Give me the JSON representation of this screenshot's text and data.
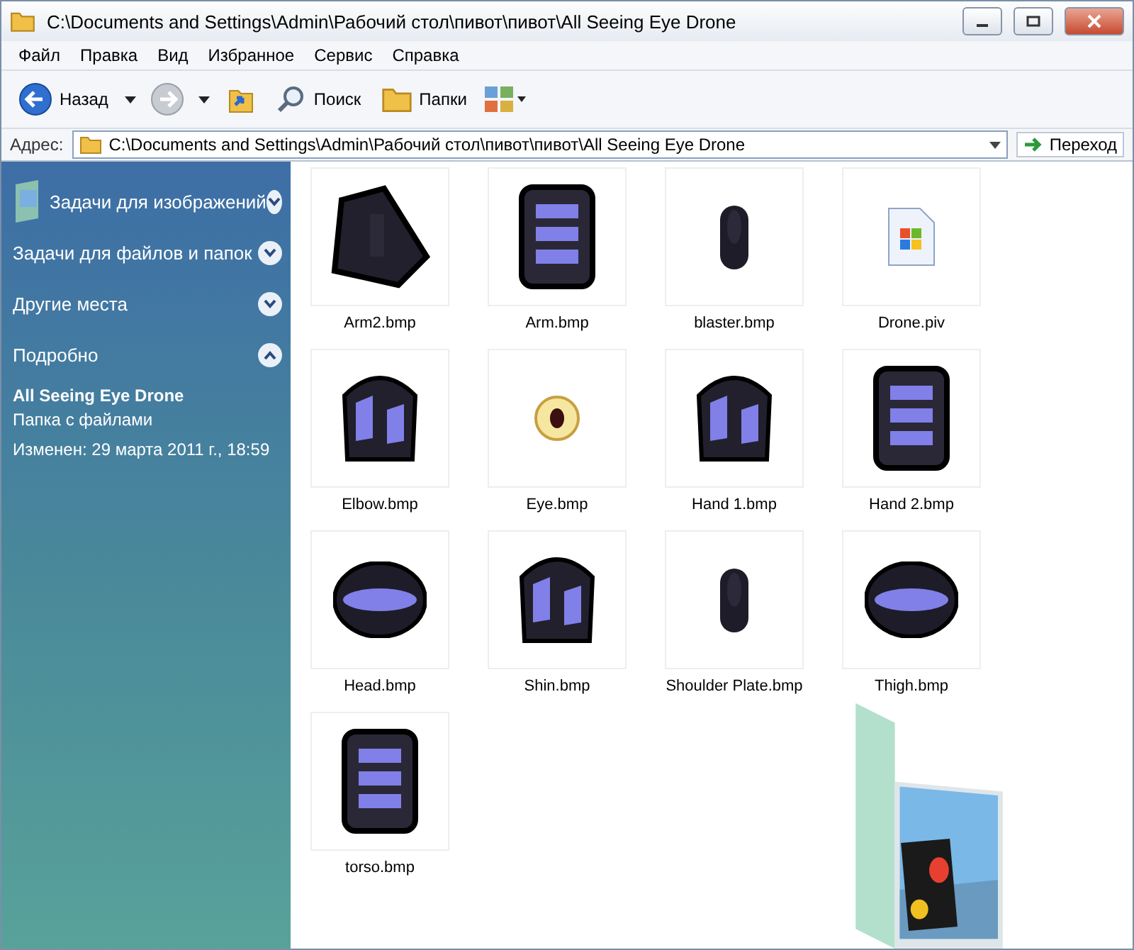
{
  "window": {
    "title": "C:\\Documents and Settings\\Admin\\Рабочий стол\\пивот\\пивот\\All Seeing Eye Drone"
  },
  "menu": [
    "Файл",
    "Правка",
    "Вид",
    "Избранное",
    "Сервис",
    "Справка"
  ],
  "toolbar": {
    "back": "Назад",
    "search": "Поиск",
    "folders": "Папки"
  },
  "address": {
    "label": "Адрес:",
    "value": "C:\\Documents and Settings\\Admin\\Рабочий стол\\пивот\\пивот\\All Seeing Eye Drone",
    "go": "Переход"
  },
  "sidebar": {
    "sections": [
      {
        "title": "Задачи для изображений",
        "expanded": false
      },
      {
        "title": "Задачи для файлов и папок",
        "expanded": false
      },
      {
        "title": "Другие места",
        "expanded": false
      },
      {
        "title": "Подробно",
        "expanded": true
      }
    ],
    "details": {
      "name": "All Seeing Eye Drone",
      "type": "Папка с файлами",
      "modified": "Изменен: 29 марта 2011 г., 18:59"
    }
  },
  "files": [
    {
      "name": "Arm2.bmp",
      "kind": "picture"
    },
    {
      "name": "Arm.bmp",
      "kind": "picture"
    },
    {
      "name": "blaster.bmp",
      "kind": "picture"
    },
    {
      "name": "Drone.piv",
      "kind": "document"
    },
    {
      "name": "Elbow.bmp",
      "kind": "picture"
    },
    {
      "name": "Eye.bmp",
      "kind": "picture"
    },
    {
      "name": "Hand 1.bmp",
      "kind": "picture"
    },
    {
      "name": "Hand 2.bmp",
      "kind": "picture"
    },
    {
      "name": "Head.bmp",
      "kind": "picture"
    },
    {
      "name": "Shin.bmp",
      "kind": "picture"
    },
    {
      "name": "Shoulder Plate.bmp",
      "kind": "picture"
    },
    {
      "name": "Thigh.bmp",
      "kind": "picture"
    },
    {
      "name": "torso.bmp",
      "kind": "picture"
    }
  ]
}
